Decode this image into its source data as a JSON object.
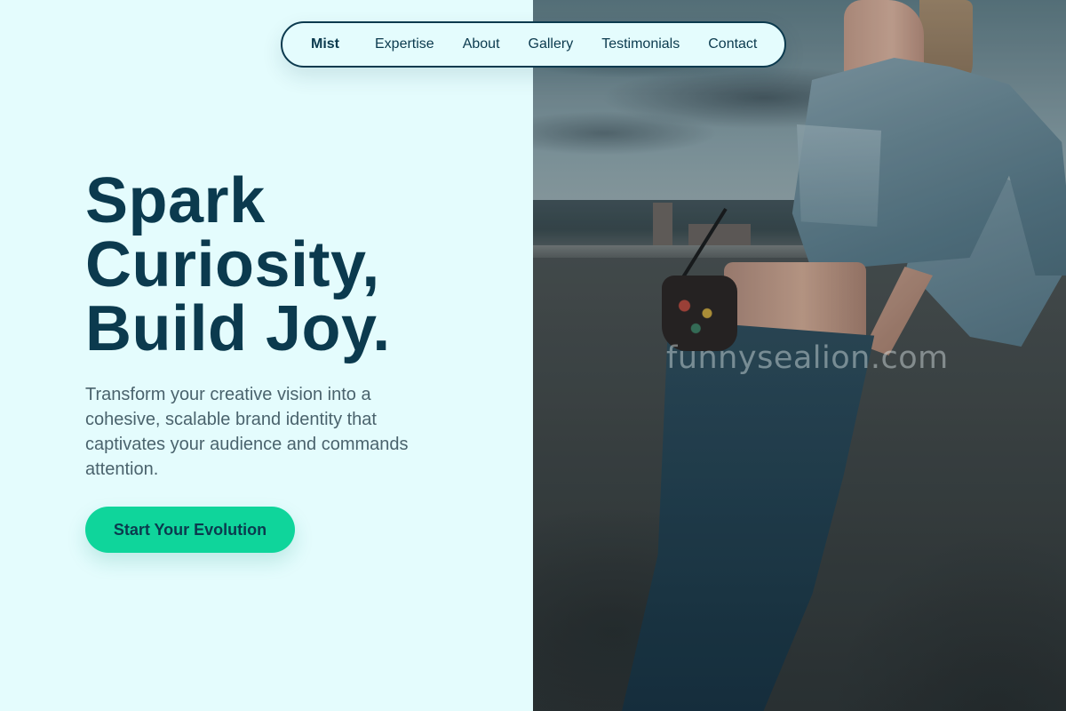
{
  "nav": {
    "brand": "Mist",
    "links": [
      "Expertise",
      "About",
      "Gallery",
      "Testimonials",
      "Contact"
    ]
  },
  "hero": {
    "headline": [
      "Spark",
      "Curiosity,",
      "Build Joy."
    ],
    "subtext": "Transform your creative vision into a cohesive, scalable brand identity that captivates your audience and commands attention.",
    "cta_label": "Start Your Evolution"
  },
  "photo": {
    "watermark": "funnysealion.com"
  },
  "colors": {
    "background": "#e4fcfd",
    "primary_text": "#0b3a4e",
    "body_text": "#4a636d",
    "accent": "#0fd59b"
  }
}
